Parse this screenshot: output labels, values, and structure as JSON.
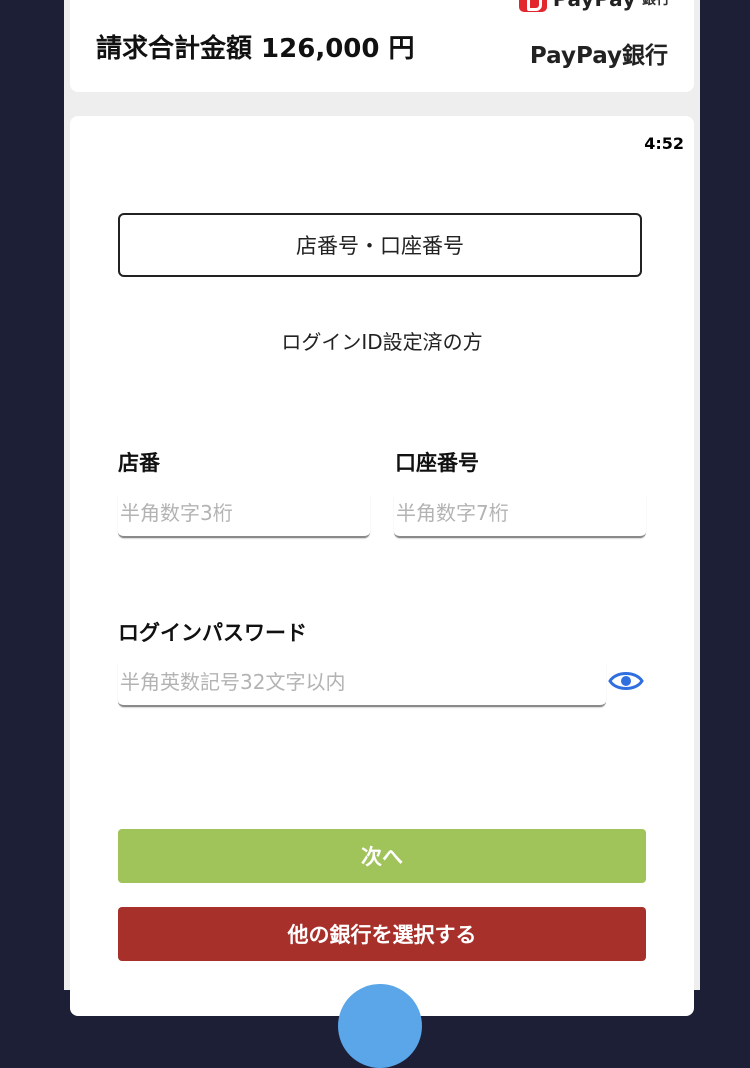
{
  "header": {
    "billing_total": "請求合計金額 126,000 円",
    "logo_text": "PayPay",
    "logo_sub": "銀行",
    "bank_name": "PayPay銀行"
  },
  "form": {
    "timer": "4:52",
    "tab_label": "店番号・口座番号",
    "login_id_link": "ログインID設定済の方",
    "branch": {
      "label": "店番",
      "placeholder": "半角数字3桁"
    },
    "account": {
      "label": "口座番号",
      "placeholder": "半角数字7桁"
    },
    "password": {
      "label": "ログインパスワード",
      "placeholder": "半角英数記号32文字以内"
    },
    "next_button": "次へ",
    "other_bank_button": "他の銀行を選択する"
  },
  "colors": {
    "page_background": "#1c1f35",
    "next_button": "#a0c35a",
    "other_bank_button": "#a8302a",
    "eye_icon": "#2f6fe0",
    "logo_red": "#e3262e"
  },
  "icons": {
    "logo": "paypay-logo-icon",
    "password_toggle": "eye-icon"
  }
}
